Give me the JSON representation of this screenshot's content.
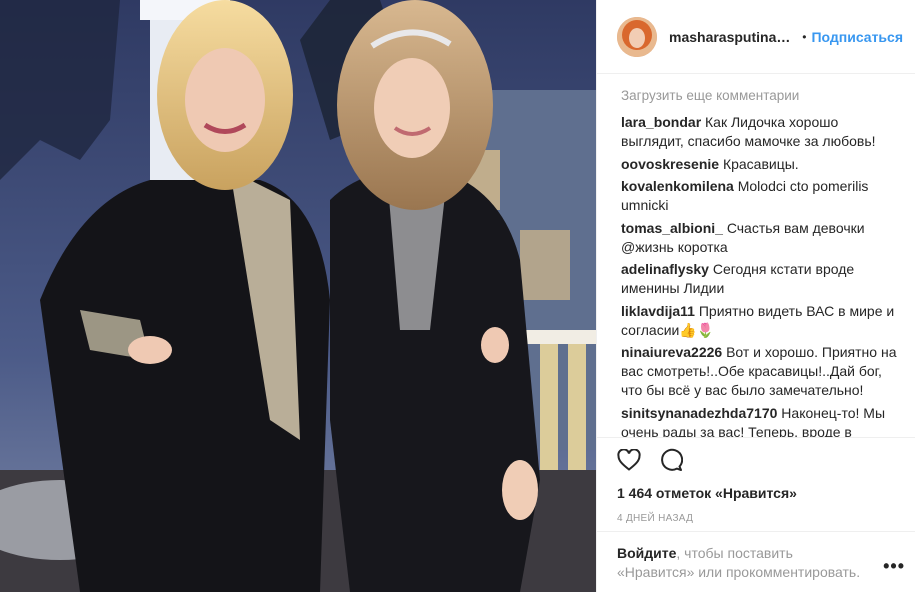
{
  "post": {
    "username": "masharasputina_offi...",
    "separator": "•",
    "follow_label": "Подписаться",
    "load_more": "Загрузить еще комментарии",
    "comments": [
      {
        "user": "lara_bondar",
        "text": "Как Лидочка хорошо выглядит, спасибо мамочке за любовь!"
      },
      {
        "user": "oovoskresenie",
        "text": "Красавицы."
      },
      {
        "user": "kovalenkomilena",
        "text": "Molodci cto pomerilis umnicki"
      },
      {
        "user": "tomas_albioni_",
        "text": "Счастья вам девочки @жизнь коротка"
      },
      {
        "user": "adelinaflysky",
        "text": "Сегодня кстати вроде именины Лидии"
      },
      {
        "user": "liklavdija11",
        "text": "Приятно видеть ВАС в мире и согласии👍🌷"
      },
      {
        "user": "ninaiureva2226",
        "text": "Вот и хорошо. Приятно на вас смотреть!..Обе красавицы!..Дай бог, что бы всё у вас было замечательно!"
      },
      {
        "user": "sinitsynanadezhda7170",
        "text": "Наконец-то! Мы очень рады за вас! Теперь, вроде в"
      }
    ],
    "likes": "1 464 отметок «Нравится»",
    "time_ago": "4 дней назад",
    "login_link": "Войдите",
    "login_text": ", чтобы поставить «Нравится» или прокомментировать.",
    "more_glyph": "•••",
    "icons": {
      "like": "heart-icon",
      "comment": "comment-icon",
      "more": "more-options-icon"
    }
  }
}
